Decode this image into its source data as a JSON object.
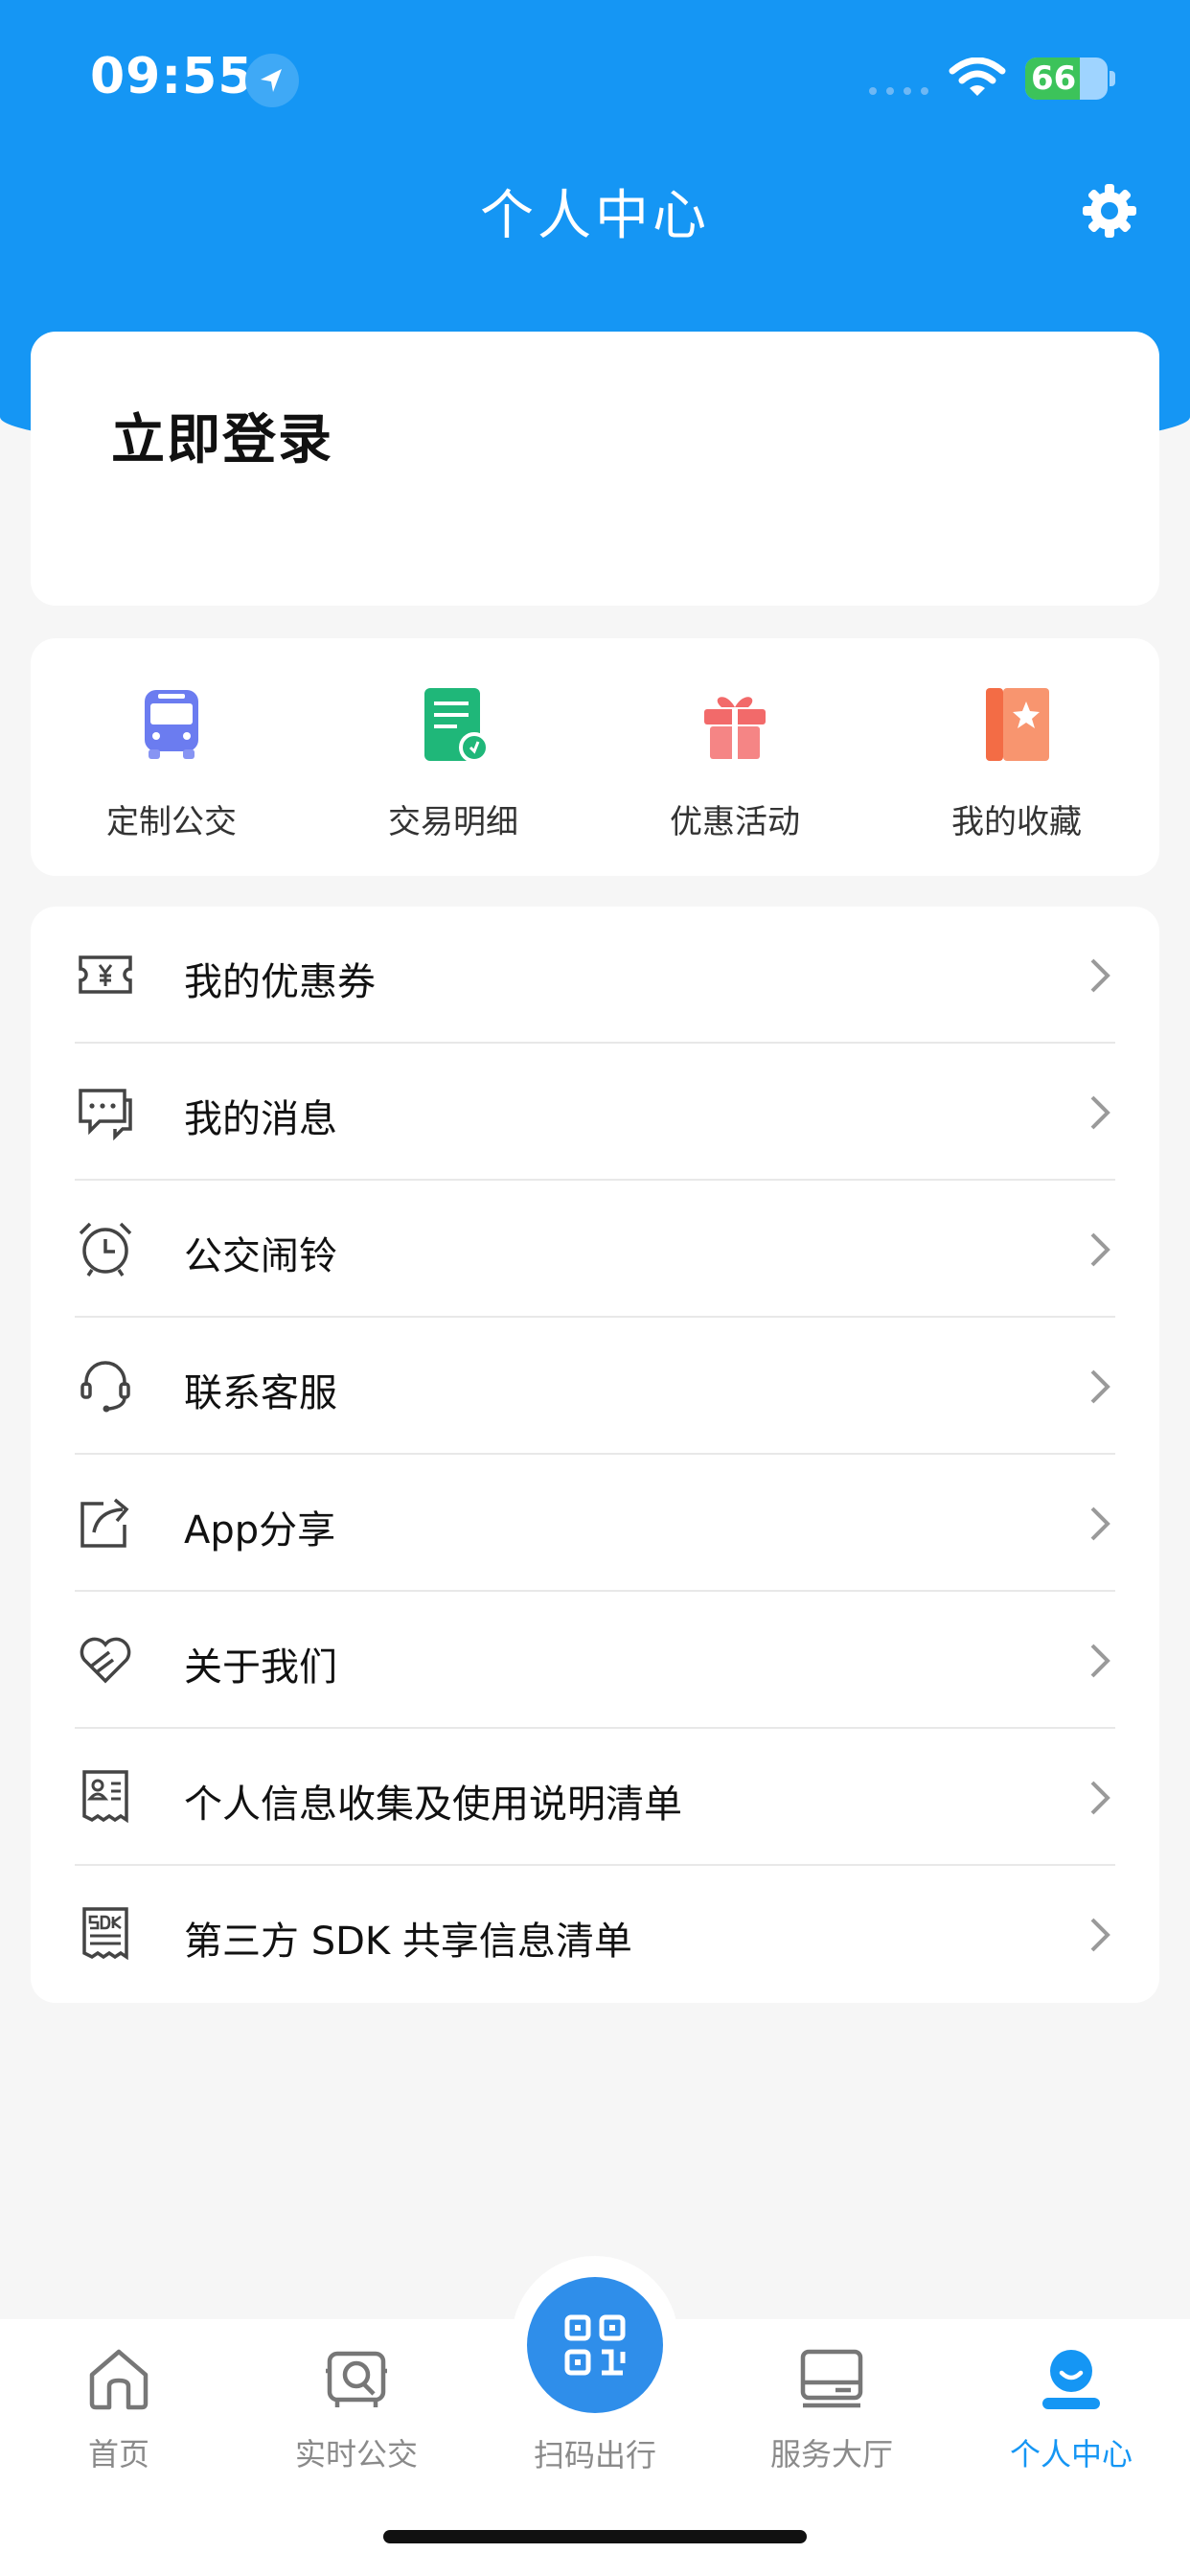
{
  "status_bar": {
    "time": "09:55",
    "battery": "66"
  },
  "header": {
    "title": "个人中心"
  },
  "login": {
    "label": "立即登录"
  },
  "quick_actions": [
    {
      "label": "定制公交",
      "icon": "bus-icon",
      "color": "#6B7CF0"
    },
    {
      "label": "交易明细",
      "icon": "transaction-document-icon",
      "color": "#1FB779"
    },
    {
      "label": "优惠活动",
      "icon": "gift-icon",
      "color": "#F26A6A"
    },
    {
      "label": "我的收藏",
      "icon": "favorites-book-icon",
      "color": "#F57A52"
    }
  ],
  "menu": [
    {
      "label": "我的优惠券",
      "icon": "coupon-icon"
    },
    {
      "label": "我的消息",
      "icon": "message-icon"
    },
    {
      "label": "公交闹铃",
      "icon": "alarm-clock-icon"
    },
    {
      "label": "联系客服",
      "icon": "headset-icon"
    },
    {
      "label": "App分享",
      "icon": "share-icon"
    },
    {
      "label": "关于我们",
      "icon": "heart-handshake-icon"
    },
    {
      "label": "个人信息收集及使用说明清单",
      "icon": "personal-info-receipt-icon"
    },
    {
      "label": "第三方 SDK 共享信息清单",
      "icon": "sdk-receipt-icon"
    }
  ],
  "tabbar": {
    "items": [
      {
        "label": "首页",
        "icon": "home-icon"
      },
      {
        "label": "实时公交",
        "icon": "realtime-bus-icon"
      },
      {
        "label": "扫码出行",
        "icon": "qr-code-icon"
      },
      {
        "label": "服务大厅",
        "icon": "service-hall-icon"
      },
      {
        "label": "个人中心",
        "icon": "profile-icon"
      }
    ],
    "active_color": "#1596F4"
  },
  "colors": {
    "primary": "#1596F4",
    "background": "#F6F6F6"
  }
}
